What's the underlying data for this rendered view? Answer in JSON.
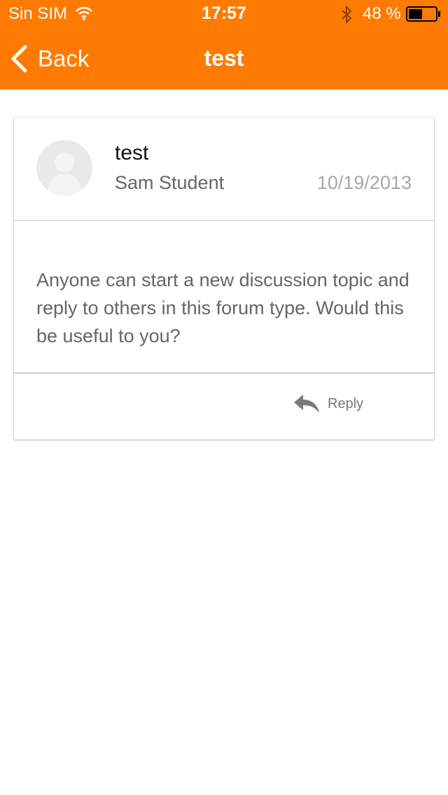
{
  "status_bar": {
    "carrier": "Sin SIM",
    "time": "17:57",
    "battery_percent": "48 %",
    "icons": [
      "wifi-icon",
      "bluetooth-icon",
      "battery-icon"
    ]
  },
  "nav": {
    "back_label": "Back",
    "title": "test",
    "accent_color": "#ff7a00"
  },
  "post": {
    "title": "test",
    "author": "Sam Student",
    "date": "10/19/2013",
    "body": "Anyone can start a new discussion topic and reply to others in this forum type. Would this be useful to you?",
    "reply_label": "Reply"
  }
}
